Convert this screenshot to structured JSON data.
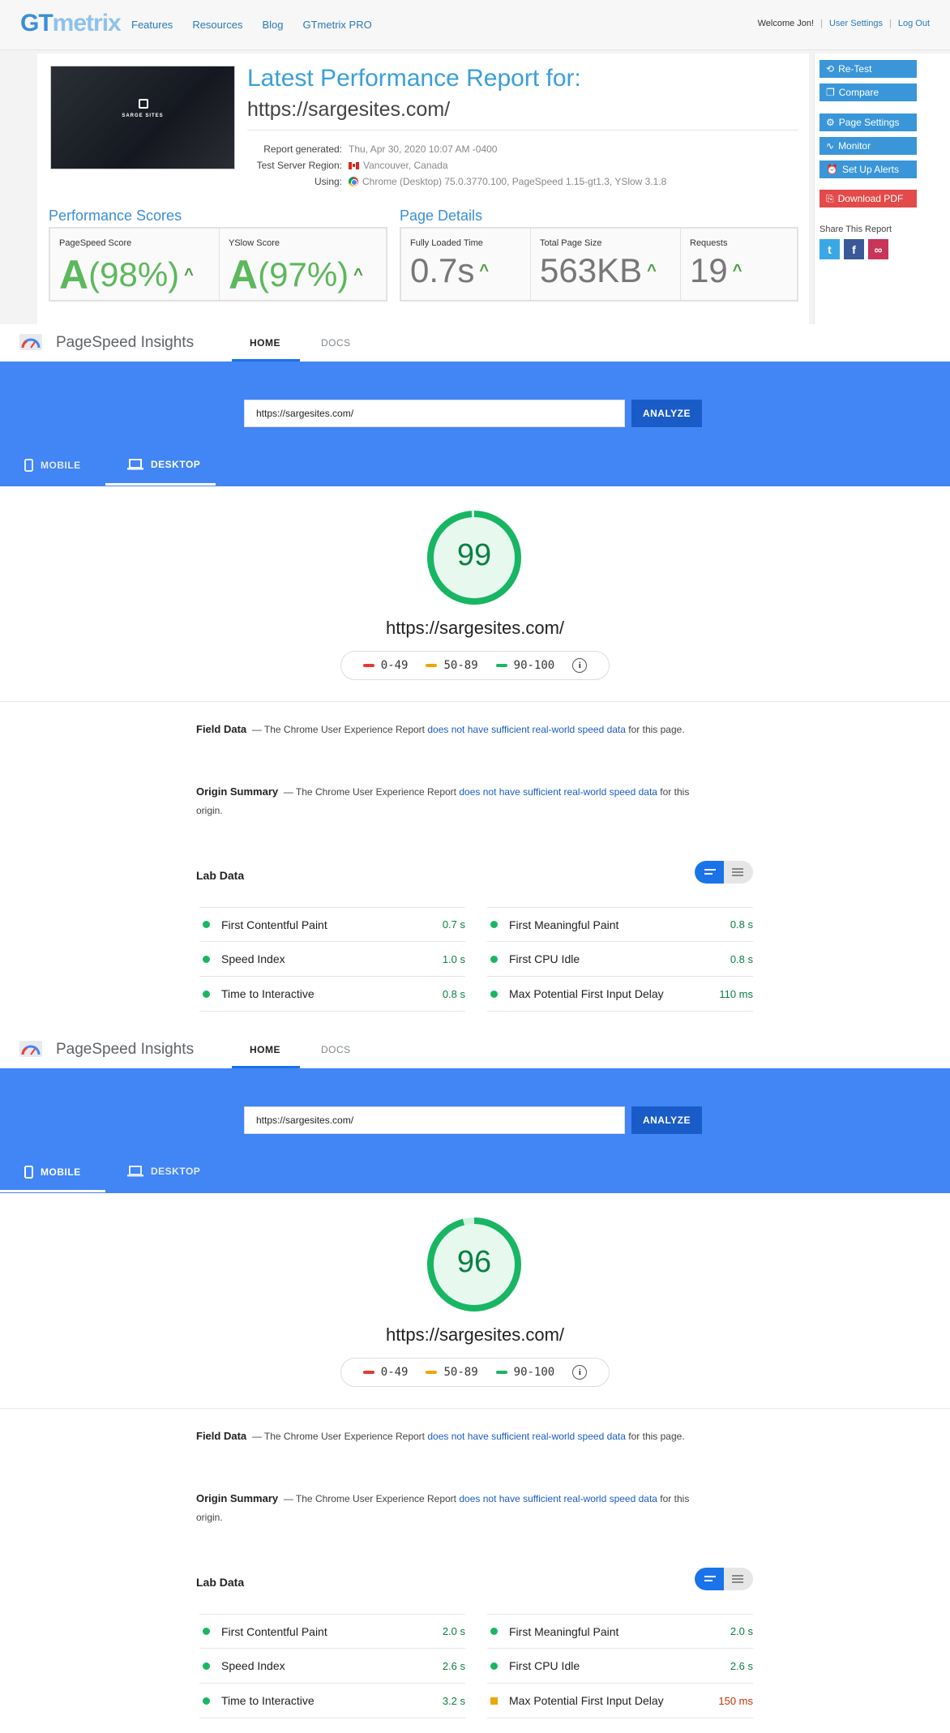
{
  "gtmetrix": {
    "logo": {
      "a": "GT",
      "b": "metrix"
    },
    "nav": [
      "Features",
      "Resources",
      "Blog",
      "GTmetrix PRO"
    ],
    "user": {
      "welcome": "Welcome Jon!",
      "settings": "User Settings",
      "logout": "Log Out",
      "sep": "|"
    },
    "thumb_brand": "SARGE SITES",
    "title": "Latest Performance Report for:",
    "url": "https://sargesites.com/",
    "info": {
      "generated_label": "Report generated:",
      "generated_value": "Thu, Apr 30, 2020 10:07 AM -0400",
      "region_label": "Test Server Region:",
      "region_value": "Vancouver, Canada",
      "using_label": "Using:",
      "using_value": "Chrome (Desktop) 75.0.3770.100, PageSpeed 1.15-gt1.3, YSlow 3.1.8"
    },
    "perf_title": "Performance Scores",
    "details_title": "Page Details",
    "scores": [
      {
        "label": "PageSpeed Score",
        "grade": "A",
        "pct": "(98%)"
      },
      {
        "label": "YSlow Score",
        "grade": "A",
        "pct": "(97%)"
      }
    ],
    "details": [
      {
        "label": "Fully Loaded Time",
        "value": "0.7s"
      },
      {
        "label": "Total Page Size",
        "value": "563KB"
      },
      {
        "label": "Requests",
        "value": "19"
      }
    ],
    "arrow": "^",
    "buttons": {
      "retest": "Re-Test",
      "compare": "Compare",
      "settings": "Page Settings",
      "monitor": "Monitor",
      "alerts": "Set Up Alerts",
      "pdf": "Download PDF"
    },
    "share": "Share This Report",
    "social": {
      "twitter": "t",
      "facebook": "f",
      "link": "∞"
    }
  },
  "psi_common": {
    "name": "PageSpeed Insights",
    "tab_home": "HOME",
    "tab_docs": "DOCS",
    "input_value": "https://sargesites.com/",
    "analyze": "ANALYZE",
    "mobile": "MOBILE",
    "desktop": "DESKTOP",
    "tested_url": "https://sargesites.com/",
    "legend": [
      "0-49",
      "50-89",
      "90-100"
    ],
    "info_icon": "i",
    "field_title": "Field Data",
    "field_pre": "— The Chrome User Experience Report ",
    "field_link": "does not have sufficient real-world speed data",
    "field_post": " for this page.",
    "origin_title": "Origin Summary",
    "origin_pre": "— The Chrome User Experience Report ",
    "origin_link": "does not have sufficient real-world speed data",
    "origin_post": " for this origin.",
    "lab_title": "Lab Data",
    "labels": {
      "fcp": "First Contentful Paint",
      "si": "Speed Index",
      "tti": "Time to Interactive",
      "fmp": "First Meaningful Paint",
      "fci": "First CPU Idle",
      "mpfid": "Max Potential First Input Delay"
    }
  },
  "desktop_report": {
    "score": "99",
    "score_value": 99,
    "fcp": "0.7 s",
    "si": "1.0 s",
    "tti": "0.8 s",
    "fmp": "0.8 s",
    "fci": "0.8 s",
    "mpfid": "110 ms"
  },
  "mobile_report": {
    "score": "96",
    "score_value": 96,
    "fcp": "2.0 s",
    "si": "2.6 s",
    "tti": "3.2 s",
    "fmp": "2.0 s",
    "fci": "2.6 s",
    "mpfid": "150 ms"
  },
  "colors": {
    "gt_blue": "#3a96d8",
    "psi_blue": "#4285f4",
    "good": "#18b663",
    "average": "#f0a500",
    "poor": "#e53935"
  }
}
